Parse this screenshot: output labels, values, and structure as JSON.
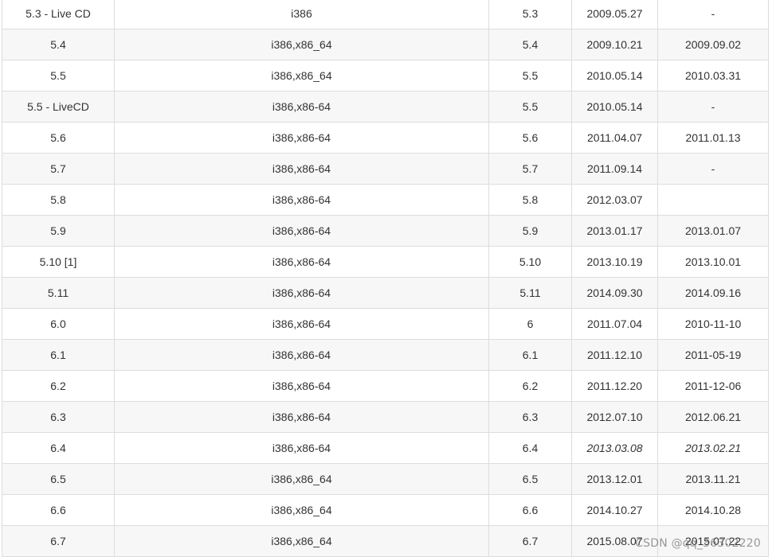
{
  "table": {
    "rows": [
      [
        "5.3 - Live CD",
        "i386",
        "5.3",
        "2009.05.27",
        "-"
      ],
      [
        "5.4",
        "i386,x86_64",
        "5.4",
        "2009.10.21",
        "2009.09.02"
      ],
      [
        "5.5",
        "i386,x86_64",
        "5.5",
        "2010.05.14",
        "2010.03.31"
      ],
      [
        "5.5 - LiveCD",
        "i386,x86-64",
        "5.5",
        "2010.05.14",
        "-"
      ],
      [
        "5.6",
        "i386,x86-64",
        "5.6",
        "2011.04.07",
        "2011.01.13"
      ],
      [
        "5.7",
        "i386,x86-64",
        "5.7",
        "2011.09.14",
        "-"
      ],
      [
        "5.8",
        "i386,x86-64",
        "5.8",
        "2012.03.07",
        ""
      ],
      [
        "5.9",
        "i386,x86-64",
        "5.9",
        "2013.01.17",
        "2013.01.07"
      ],
      [
        "5.10 [1]",
        "i386,x86-64",
        "5.10",
        "2013.10.19",
        "2013.10.01"
      ],
      [
        "5.11",
        "i386,x86-64",
        "5.11",
        "2014.09.30",
        "2014.09.16"
      ],
      [
        "6.0",
        "i386,x86-64",
        "6",
        "2011.07.04",
        "2010-11-10"
      ],
      [
        "6.1",
        "i386,x86-64",
        "6.1",
        "2011.12.10",
        "2011-05-19"
      ],
      [
        "6.2",
        "i386,x86-64",
        "6.2",
        "2011.12.20",
        "2011-12-06"
      ],
      [
        "6.3",
        "i386,x86-64",
        "6.3",
        "2012.07.10",
        "2012.06.21"
      ],
      [
        "6.4",
        "i386,x86-64",
        "6.4",
        "2013.03.08",
        "2013.02.21"
      ],
      [
        "6.5",
        "i386,x86_64",
        "6.5",
        "2013.12.01",
        "2013.11.21"
      ],
      [
        "6.6",
        "i386,x86_64",
        "6.6",
        "2014.10.27",
        "2014.10.28"
      ],
      [
        "6.7",
        "i386,x86_64",
        "6.7",
        "2015.08.07",
        "2015.07.22"
      ]
    ],
    "italic_row_index": 14
  },
  "watermark": "CSDN @qq_36302220"
}
